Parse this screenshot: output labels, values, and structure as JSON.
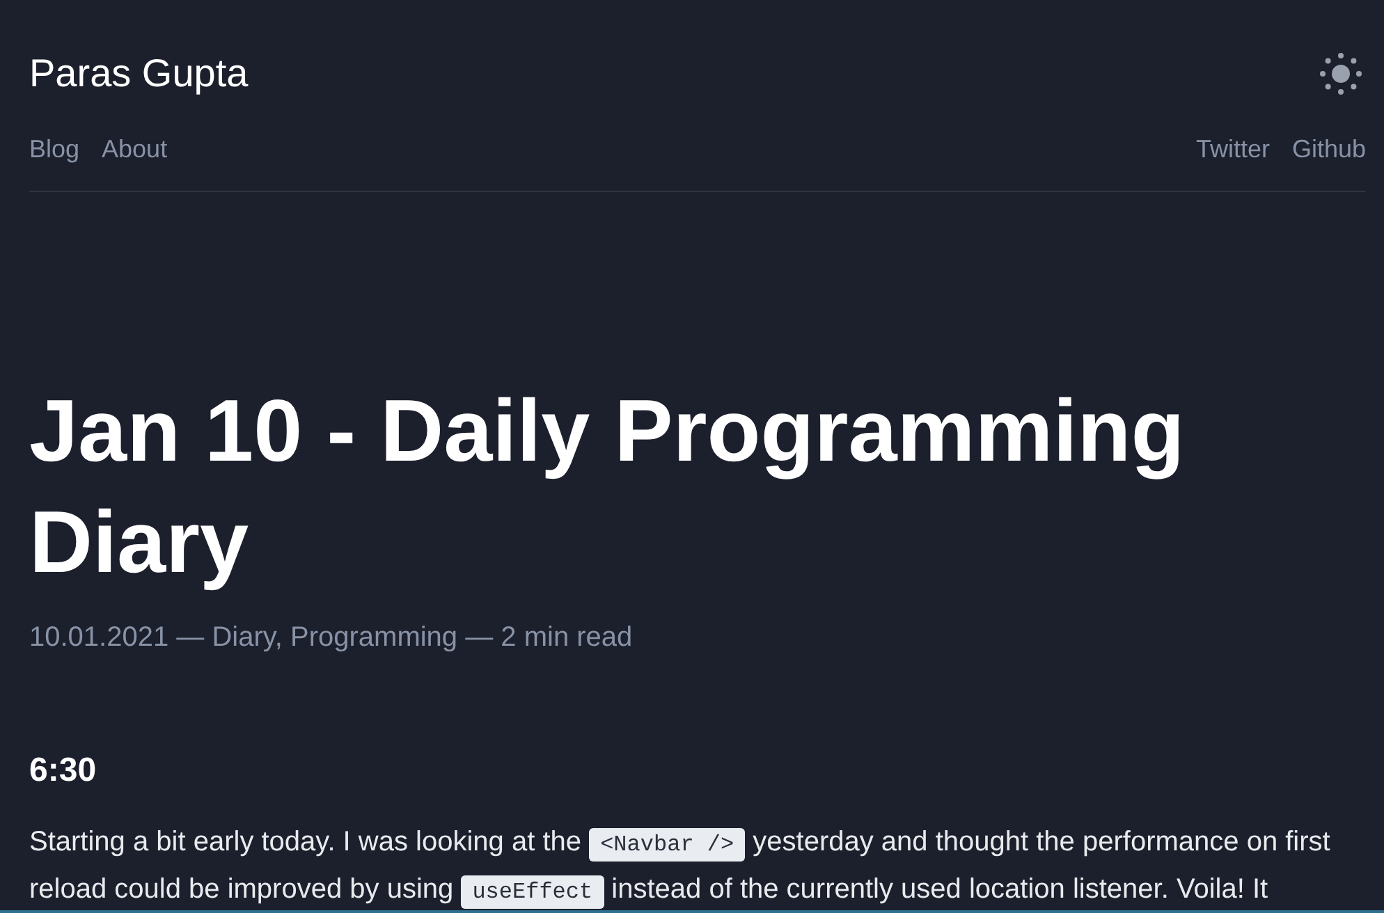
{
  "site": {
    "title": "Paras Gupta"
  },
  "nav_left": [
    {
      "label": "Blog"
    },
    {
      "label": "About"
    }
  ],
  "nav_right": [
    {
      "label": "Twitter"
    },
    {
      "label": "Github"
    }
  ],
  "post": {
    "title": "Jan 10 - Daily Programming Diary",
    "meta": "10.01.2021 — Diary, Programming — 2 min read",
    "sections": [
      {
        "heading": "6:30",
        "paragraph": [
          {
            "kind": "text",
            "text": "Starting a bit early today. I was looking at the "
          },
          {
            "kind": "code",
            "text": "<Navbar />"
          },
          {
            "kind": "text",
            "text": " yesterday and thought the performance on first reload could be improved by using "
          },
          {
            "kind": "code",
            "text": "useEffect"
          },
          {
            "kind": "text",
            "text": " instead of the currently used location listener. Voila! It"
          }
        ]
      }
    ]
  }
}
